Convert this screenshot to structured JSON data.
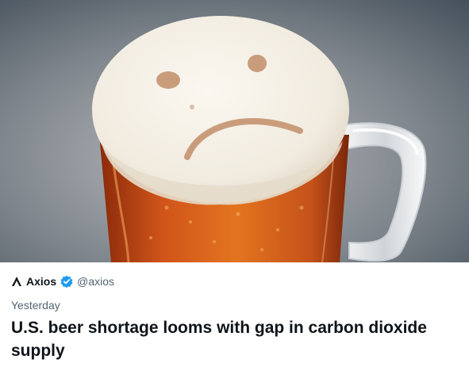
{
  "card": {
    "author": {
      "logo_icon": "axios-caret-icon",
      "name": "Axios",
      "verified_icon": "verified-badge-icon",
      "handle": "@axios"
    },
    "timestamp": "Yesterday",
    "headline": "U.S. beer shortage looms with gap in carbon dioxide supply"
  },
  "colors": {
    "text_primary": "#0f1419",
    "text_secondary": "#536471",
    "verified_blue": "#1d9bf0"
  }
}
